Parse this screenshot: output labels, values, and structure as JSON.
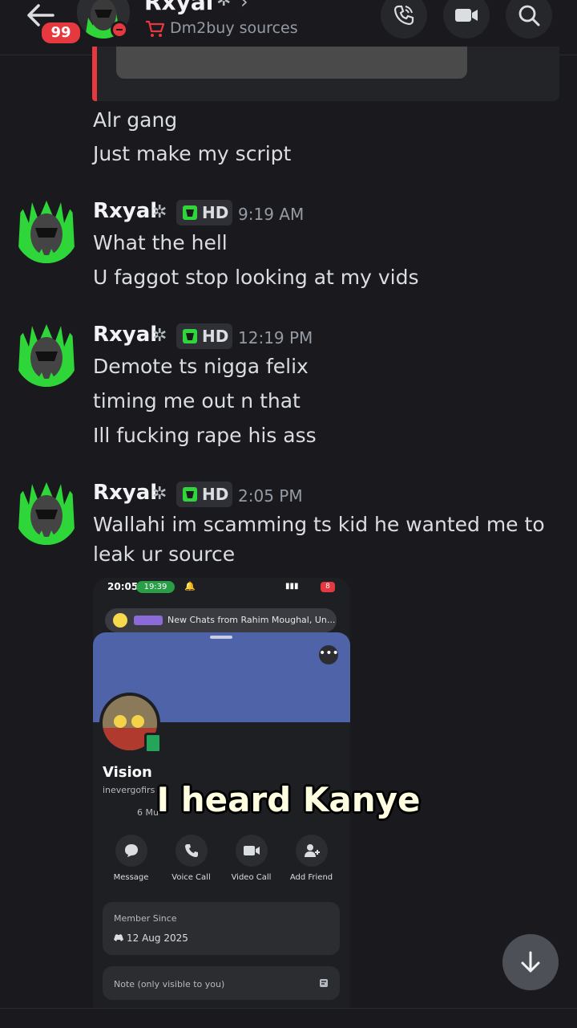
{
  "header": {
    "badge_count": "99",
    "name": "Rxyal",
    "name_glyph": "✲",
    "chevron": "›",
    "subtitle": "Dm2buy sources",
    "icons": [
      "back-arrow-icon",
      "voice-call-icon",
      "video-call-icon",
      "search-icon"
    ]
  },
  "messages": {
    "cont1": "Alr gang",
    "cont2": "Just make my script",
    "groups": [
      {
        "author": "Rxyal",
        "tag": "HD",
        "time": "9:19 AM",
        "lines": [
          "What the hell",
          "U faggot stop looking at my vids"
        ]
      },
      {
        "author": "Rxyal",
        "tag": "HD",
        "time": "12:19 PM",
        "lines": [
          "Demote ts nigga felix",
          "timing me out n that",
          "Ill fucking rape his ass"
        ]
      },
      {
        "author": "Rxyal",
        "tag": "HD",
        "time": "2:05 PM",
        "lines": [
          "Wallahi im scamming ts kid he wanted me to",
          "leak ur source"
        ]
      }
    ]
  },
  "attachment": {
    "status_time": "20:05",
    "call_pill": "19:39",
    "notif_text": "New Chats from Rahim Moughal, Un...",
    "name": "Vision",
    "handle": "inevergofirs",
    "mutual_prefix": "6 Mu",
    "actions": [
      "Message",
      "Voice Call",
      "Video Call",
      "Add Friend"
    ],
    "member_since_title": "Member Since",
    "member_since_date": "12 Aug 2025",
    "note_placeholder": "Note (only visible to you)"
  },
  "caption": "I heard Kanye",
  "colors": {
    "background": "#1a1a1e",
    "accent_red": "#e5393f",
    "banner_blue": "#4f63a8",
    "online_green": "#23a55a"
  }
}
